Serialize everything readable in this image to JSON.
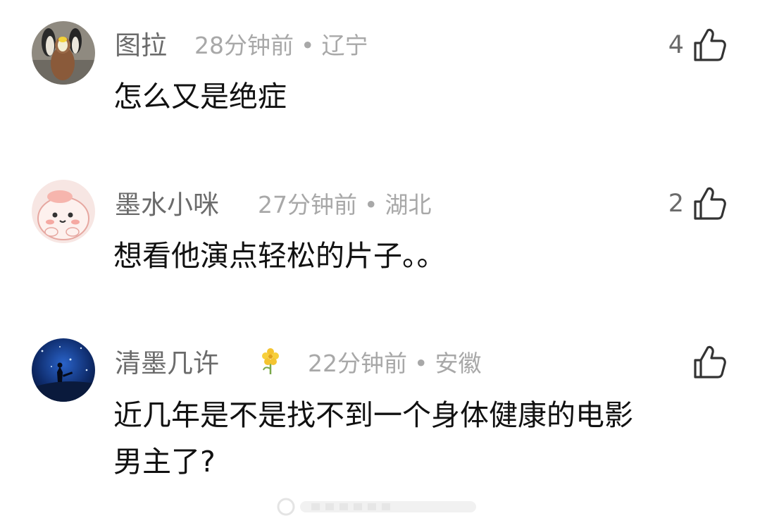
{
  "comments": [
    {
      "username": "图拉",
      "time": "28分钟前",
      "separator": "•",
      "location": "辽宁",
      "likes": "4",
      "text": "怎么又是绝症",
      "avatar_icon": "penguin-photo-avatar",
      "like_icon": "thumbs-up-icon"
    },
    {
      "username": "墨水小咪",
      "time": "27分钟前",
      "separator": "•",
      "location": "湖北",
      "likes": "2",
      "text": "想看他演点轻松的片子。。",
      "avatar_icon": "pink-cartoon-avatar",
      "like_icon": "thumbs-up-icon"
    },
    {
      "username": "清墨几许",
      "time": "22分钟前",
      "separator": "•",
      "location": "安徽",
      "likes": "",
      "text_line1": "近几年是不是找不到一个身体健康的电影",
      "text_line2": "男主了?",
      "badge_icon": "yellow-flower-badge-icon",
      "avatar_icon": "starry-night-avatar",
      "like_icon": "thumbs-up-icon"
    }
  ],
  "colors": {
    "username": "#6b6b6b",
    "meta": "#a8a8a8",
    "text": "#111111"
  }
}
